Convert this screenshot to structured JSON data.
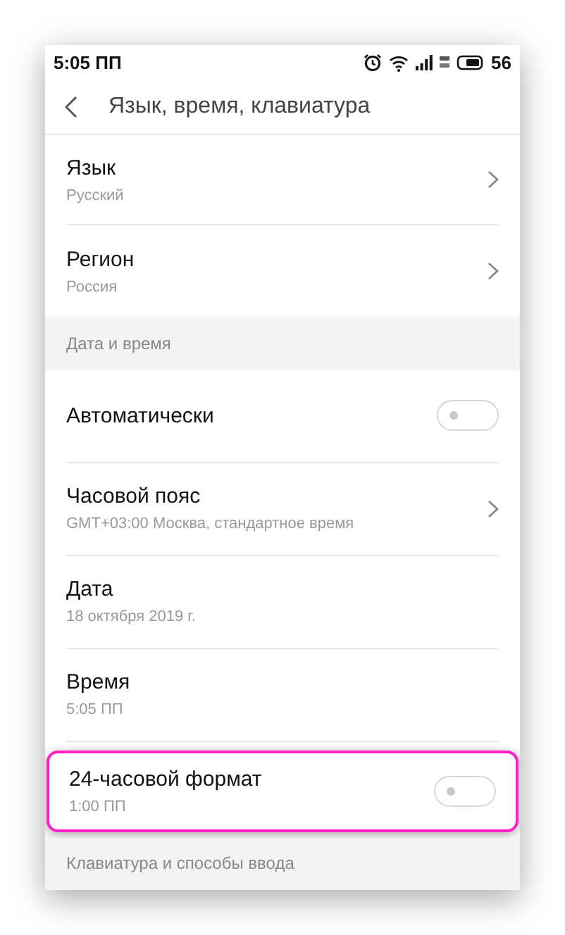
{
  "status_bar": {
    "time": "5:05 ПП",
    "battery": "56"
  },
  "header": {
    "title": "Язык, время, клавиатура"
  },
  "sections": [
    {
      "items": [
        {
          "kind": "nav",
          "title": "Язык",
          "subtitle": "Русский"
        },
        {
          "kind": "nav",
          "title": "Регион",
          "subtitle": "Россия"
        }
      ]
    },
    {
      "heading": "Дата и время",
      "items": [
        {
          "kind": "toggle",
          "title": "Автоматически",
          "on": false
        },
        {
          "kind": "nav",
          "title": "Часовой пояс",
          "subtitle": "GMT+03:00 Москва, стандартное время"
        },
        {
          "kind": "plain",
          "title": "Дата",
          "subtitle": "18 октября 2019 г."
        },
        {
          "kind": "plain",
          "title": "Время",
          "subtitle": "5:05 ПП"
        },
        {
          "kind": "toggle",
          "title": "24-часовой формат",
          "subtitle": "1:00 ПП",
          "on": false,
          "highlighted": true
        }
      ]
    },
    {
      "heading": "Клавиатура и способы ввода"
    }
  ]
}
